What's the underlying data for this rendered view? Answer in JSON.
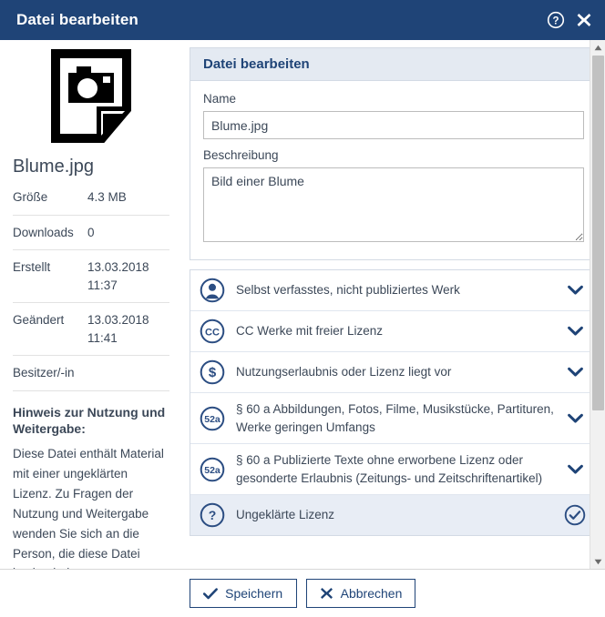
{
  "window": {
    "title": "Datei bearbeiten",
    "help_icon": "question-circle-icon",
    "close_icon": "close-icon",
    "accent_color": "#1f4477",
    "titlebar_bg": "#1f4477",
    "panel_header_bg": "#e4eaf2",
    "selected_row_bg": "#e8edf5"
  },
  "sidebar": {
    "file_icon": "image-file-icon",
    "filename": "Blume.jpg",
    "meta": [
      {
        "key": "Größe",
        "value": "4.3 MB"
      },
      {
        "key": "Downloads",
        "value": "0"
      },
      {
        "key": "Erstellt",
        "value": "13.03.2018 11:37"
      },
      {
        "key": "Geändert",
        "value": "13.03.2018 11:41"
      },
      {
        "key": "Besitzer/-in",
        "value": ""
      }
    ],
    "notice_title": "Hinweis zur Nutzung und Weitergabe:",
    "notice_text": "Diese Datei enthält Material mit einer ungeklärten Lizenz. Zu Fragen der Nutzung und Weitergabe wenden Sie sich an die Person, die diese Datei hochgeladen"
  },
  "main": {
    "panel_title": "Datei bearbeiten",
    "name_label": "Name",
    "name_value": "Blume.jpg",
    "name_placeholder": "Name",
    "description_label": "Beschreibung",
    "description_value": "Bild einer Blume",
    "description_placeholder": "Beschreibung",
    "licenses": [
      {
        "icon": "person-circle-icon",
        "label": "Selbst verfasstes, nicht publiziertes Werk",
        "trailing_icon": "chevron-down-icon",
        "selected": false
      },
      {
        "icon": "creative-commons-icon",
        "label": "CC Werke mit freier Lizenz",
        "trailing_icon": "chevron-down-icon",
        "selected": false
      },
      {
        "icon": "dollar-circle-icon",
        "label": "Nutzungserlaubnis oder Lizenz liegt vor",
        "trailing_icon": "chevron-down-icon",
        "selected": false
      },
      {
        "icon": "paragraph-52a-icon",
        "label": "§ 60 a Abbildungen, Fotos, Filme, Musikstücke, Partituren, Werke geringen Umfangs",
        "trailing_icon": "chevron-down-icon",
        "selected": false
      },
      {
        "icon": "paragraph-52a-icon",
        "label": "§ 60 a Publizierte Texte ohne erworbene Lizenz oder gesonderte Erlaubnis (Zeitungs- und Zeitschriftenartikel)",
        "trailing_icon": "chevron-down-icon",
        "selected": false
      },
      {
        "icon": "question-circle-icon",
        "label": "Ungeklärte Lizenz",
        "trailing_icon": "check-circle-icon",
        "selected": true
      }
    ]
  },
  "scrollbar": {
    "up_arrow_icon": "triangle-up-icon",
    "down_arrow_icon": "triangle-down-icon"
  },
  "footer": {
    "save_label": "Speichern",
    "save_icon": "check-icon",
    "cancel_label": "Abbrechen",
    "cancel_icon": "close-icon"
  }
}
